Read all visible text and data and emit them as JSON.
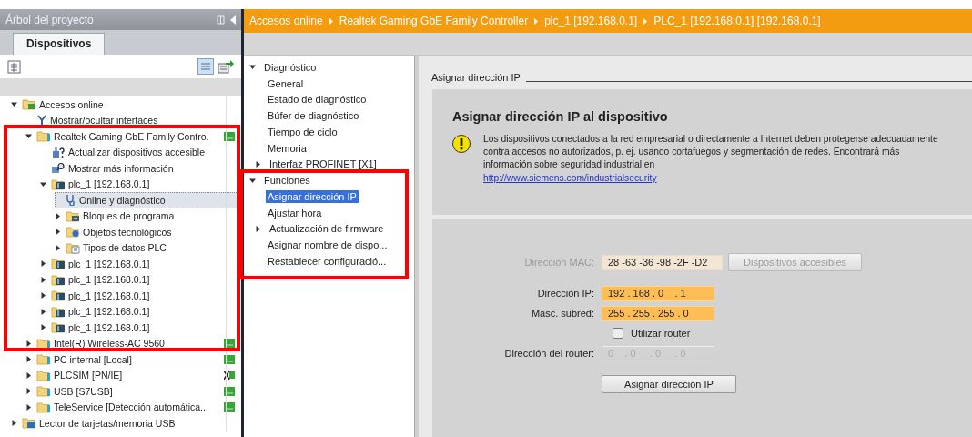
{
  "project_tree": {
    "title": "Árbol del proyecto",
    "tabs": [
      {
        "label": "Dispositivos",
        "selected": true
      }
    ],
    "nodes": [
      {
        "label": "Accesos online",
        "kind": "online-folder",
        "expanded": true,
        "selected": false,
        "children": [
          {
            "label": "Mostrar/ocultar interfaces",
            "kind": "interfaces",
            "selected": false
          },
          {
            "label": "Realtek Gaming GbE Family Contro.",
            "kind": "adapter",
            "expanded": true,
            "selected": false,
            "online": true,
            "children": [
              {
                "label": "Actualizar dispositivos accesible",
                "kind": "update",
                "selected": false
              },
              {
                "label": "Mostrar más información",
                "kind": "info",
                "selected": false
              },
              {
                "label": "plc_1 [192.168.0.1]",
                "kind": "plc",
                "expanded": true,
                "selected": false,
                "children": [
                  {
                    "label": "Online y diagnóstico",
                    "kind": "diagnostic",
                    "selected": true
                  },
                  {
                    "label": "Bloques de programa",
                    "kind": "blocks",
                    "expanded": false,
                    "selected": false
                  },
                  {
                    "label": "Objetos tecnológicos",
                    "kind": "tech",
                    "expanded": false,
                    "selected": false
                  },
                  {
                    "label": "Tipos de datos PLC",
                    "kind": "types",
                    "expanded": false,
                    "selected": false
                  }
                ]
              },
              {
                "label": "plc_1 [192.168.0.1]",
                "kind": "plc",
                "expanded": false,
                "selected": false
              },
              {
                "label": "plc_1 [192.168.0.1]",
                "kind": "plc",
                "expanded": false,
                "selected": false
              },
              {
                "label": "plc_1 [192.168.0.1]",
                "kind": "plc",
                "expanded": false,
                "selected": false
              },
              {
                "label": "plc_1 [192.168.0.1]",
                "kind": "plc",
                "expanded": false,
                "selected": false
              },
              {
                "label": "plc_1 [192.168.0.1]",
                "kind": "plc",
                "expanded": false,
                "selected": false
              }
            ]
          },
          {
            "label": "Intel(R) Wireless-AC 9560",
            "kind": "adapter",
            "expanded": false,
            "selected": false,
            "online": true
          },
          {
            "label": "PC internal [Local]",
            "kind": "adapter",
            "expanded": false,
            "selected": false,
            "online": true
          },
          {
            "label": "PLCSIM [PN/IE]",
            "kind": "adapter",
            "expanded": false,
            "selected": false,
            "online": false
          },
          {
            "label": "USB [S7USB]",
            "kind": "adapter",
            "expanded": false,
            "selected": false,
            "online": true
          },
          {
            "label": "TeleService [Detección automática..",
            "kind": "adapter",
            "expanded": false,
            "selected": false,
            "online": true
          }
        ]
      },
      {
        "label": "Lector de tarjetas/memoria USB",
        "kind": "card-reader",
        "expanded": false,
        "selected": false
      }
    ]
  },
  "breadcrumb": [
    "Accesos online",
    "Realtek Gaming GbE Family Controller",
    "plc_1 [192.168.0.1]",
    "PLC_1 [192.168.0.1] [192.168.0.1]"
  ],
  "nav": [
    {
      "label": "Diagnóstico",
      "expanded": true,
      "children": [
        {
          "label": "General",
          "selected": false
        },
        {
          "label": "Estado de diagnóstico",
          "selected": false
        },
        {
          "label": "Búfer de diagnóstico",
          "selected": false
        },
        {
          "label": "Tiempo de ciclo",
          "selected": false
        },
        {
          "label": "Memoria",
          "selected": false
        },
        {
          "label": "Interfaz PROFINET [X1]",
          "selected": false,
          "expanded": false
        }
      ]
    },
    {
      "label": "Funciones",
      "expanded": true,
      "children": [
        {
          "label": "Asignar dirección IP",
          "selected": true
        },
        {
          "label": "Ajustar hora",
          "selected": false
        },
        {
          "label": "Actualización de firmware",
          "selected": false,
          "expanded": false
        },
        {
          "label": "Asignar nombre de dispo...",
          "selected": false
        },
        {
          "label": "Restablecer configuració...",
          "selected": false
        }
      ]
    }
  ],
  "section": {
    "title": "Asignar dirección IP",
    "heading": "Asignar dirección IP al dispositivo",
    "warning": "Los dispositivos conectados a la red empresarial o directamente a Internet deben protegerse adecuadamente contra accesos no autorizados, p. ej. usando cortafuegos y segmentación de redes. Encontrará más información sobre seguridad industrial en",
    "link": "http://www.siemens.com/industrialsecurity",
    "form": [
      {
        "kind": "readonly",
        "label": "Dirección MAC:",
        "value": "28 -63 -36 -98 -2F -D2",
        "button": {
          "label": "Dispositivos accesibles",
          "disabled": true
        }
      },
      {
        "kind": "input",
        "label": "Dirección IP:",
        "value": "192 . 168 . 0    . 1"
      },
      {
        "kind": "input",
        "label": "Másc. subred:",
        "value": "255 . 255 . 255 . 0"
      },
      {
        "kind": "checkbox",
        "label": "Utilizar router",
        "checked": false
      },
      {
        "kind": "disabled",
        "label": "Dirección del router:",
        "value": "0    . 0     . 0     . 0"
      }
    ],
    "action": {
      "label": "Asignar dirección IP",
      "disabled": false
    }
  }
}
